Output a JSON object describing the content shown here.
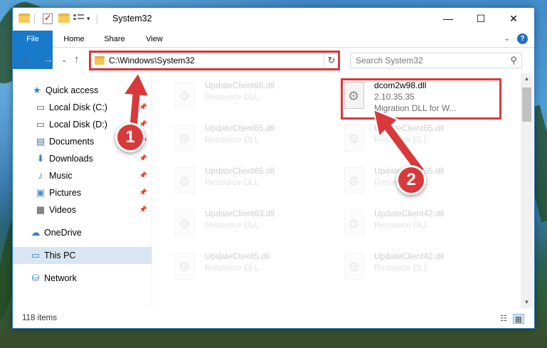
{
  "window": {
    "title": "System32",
    "controls": {
      "minimize": "—",
      "maximize": "☐",
      "close": "✕"
    }
  },
  "ribbon": {
    "tabs": [
      "File",
      "Home",
      "Share",
      "View"
    ],
    "expand": "⌄",
    "help": "?"
  },
  "address": {
    "path": "C:\\Windows\\System32",
    "dropdown": "⌄",
    "refresh": "↻"
  },
  "search": {
    "placeholder": "Search System32",
    "icon": "⚲"
  },
  "nav": {
    "back": "←",
    "forward": "→",
    "recent": "⌄",
    "up": "↑",
    "items": [
      {
        "label": "Quick access",
        "icon": "star-icon",
        "glyph": "★",
        "color": "#2f7fd2",
        "pinned": false
      },
      {
        "label": "Local Disk (C:)",
        "icon": "drive-icon",
        "glyph": "▭",
        "color": "#555555",
        "pinned": true
      },
      {
        "label": "Local Disk (D:)",
        "icon": "drive-icon",
        "glyph": "▭",
        "color": "#555555",
        "pinned": true
      },
      {
        "label": "Documents",
        "icon": "documents-icon",
        "glyph": "▤",
        "color": "#4a6fa5",
        "pinned": true
      },
      {
        "label": "Downloads",
        "icon": "downloads-icon",
        "glyph": "⬇",
        "color": "#2f7fd2",
        "pinned": true
      },
      {
        "label": "Music",
        "icon": "music-icon",
        "glyph": "♪",
        "color": "#2f7fd2",
        "pinned": true
      },
      {
        "label": "Pictures",
        "icon": "pictures-icon",
        "glyph": "▣",
        "color": "#4a8fc9",
        "pinned": true
      },
      {
        "label": "Videos",
        "icon": "videos-icon",
        "glyph": "▦",
        "color": "#444444",
        "pinned": true
      },
      {
        "label": "OneDrive",
        "icon": "onedrive-icon",
        "glyph": "☁",
        "color": "#2f7fd2",
        "pinned": false
      },
      {
        "label": "This PC",
        "icon": "computer-icon",
        "glyph": "▭",
        "color": "#2f7fd2",
        "pinned": false,
        "selected": true
      },
      {
        "label": "Network",
        "icon": "network-icon",
        "glyph": "⛁",
        "color": "#2f7fd2",
        "pinned": false
      }
    ]
  },
  "files": [
    {
      "name": "UpdateClient65.dll",
      "type": "Resource DLL",
      "faded": true
    },
    {
      "name": "dcom2w98.dll",
      "version": "2.10.35.35",
      "description": "Migration DLL for W...",
      "faded": false,
      "highlighted": true
    },
    {
      "name": "UpdateClient65.dll",
      "type": "Resource DLL",
      "faded": true
    },
    {
      "name": "UpdateClient65.dll",
      "type": "Resource DLL",
      "faded": true
    },
    {
      "name": "UpdateClient65.dll",
      "type": "Resource DLL",
      "faded": true
    },
    {
      "name": "UpdateClient65.dll",
      "type": "Resource DLL",
      "faded": true
    },
    {
      "name": "UpdateClient63.dll",
      "type": "Resource DLL",
      "faded": true
    },
    {
      "name": "UpdateClient42.dll",
      "type": "Resource DLL",
      "faded": true
    },
    {
      "name": "UpdateClient5.dll",
      "type": "Resource DLL",
      "faded": true
    },
    {
      "name": "UpdateClient42.dll",
      "type": "Resource DLL",
      "faded": true
    }
  ],
  "status": {
    "item_count": "118 items"
  },
  "annotations": {
    "step1": "1",
    "step2": "2",
    "color": "#d8393b"
  }
}
